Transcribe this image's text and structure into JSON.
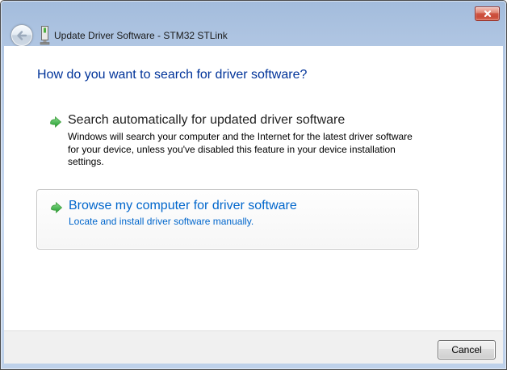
{
  "titlebar": {
    "title": "Update Driver Software - STM32 STLink"
  },
  "content": {
    "heading": "How do you want to search for driver software?",
    "options": [
      {
        "title": "Search automatically for updated driver software",
        "description": "Windows will search your computer and the Internet for the latest driver software\nfor your device, unless you've disabled this feature in your device installation\nsettings."
      },
      {
        "title": "Browse my computer for driver software",
        "description": "Locate and install driver software manually."
      }
    ]
  },
  "footer": {
    "cancel_label": "Cancel"
  },
  "colors": {
    "heading_blue": "#003399",
    "command_link_blue": "#0066cc",
    "arrow_green": "#2fae43",
    "glass_blue": "#b7cbe7",
    "close_red": "#cf5240",
    "footer_gray": "#f0f0f0"
  },
  "icons": {
    "close": "close-icon",
    "back": "back-arrow-icon",
    "device": "driver-device-icon",
    "command_arrow": "green-arrow-icon"
  }
}
